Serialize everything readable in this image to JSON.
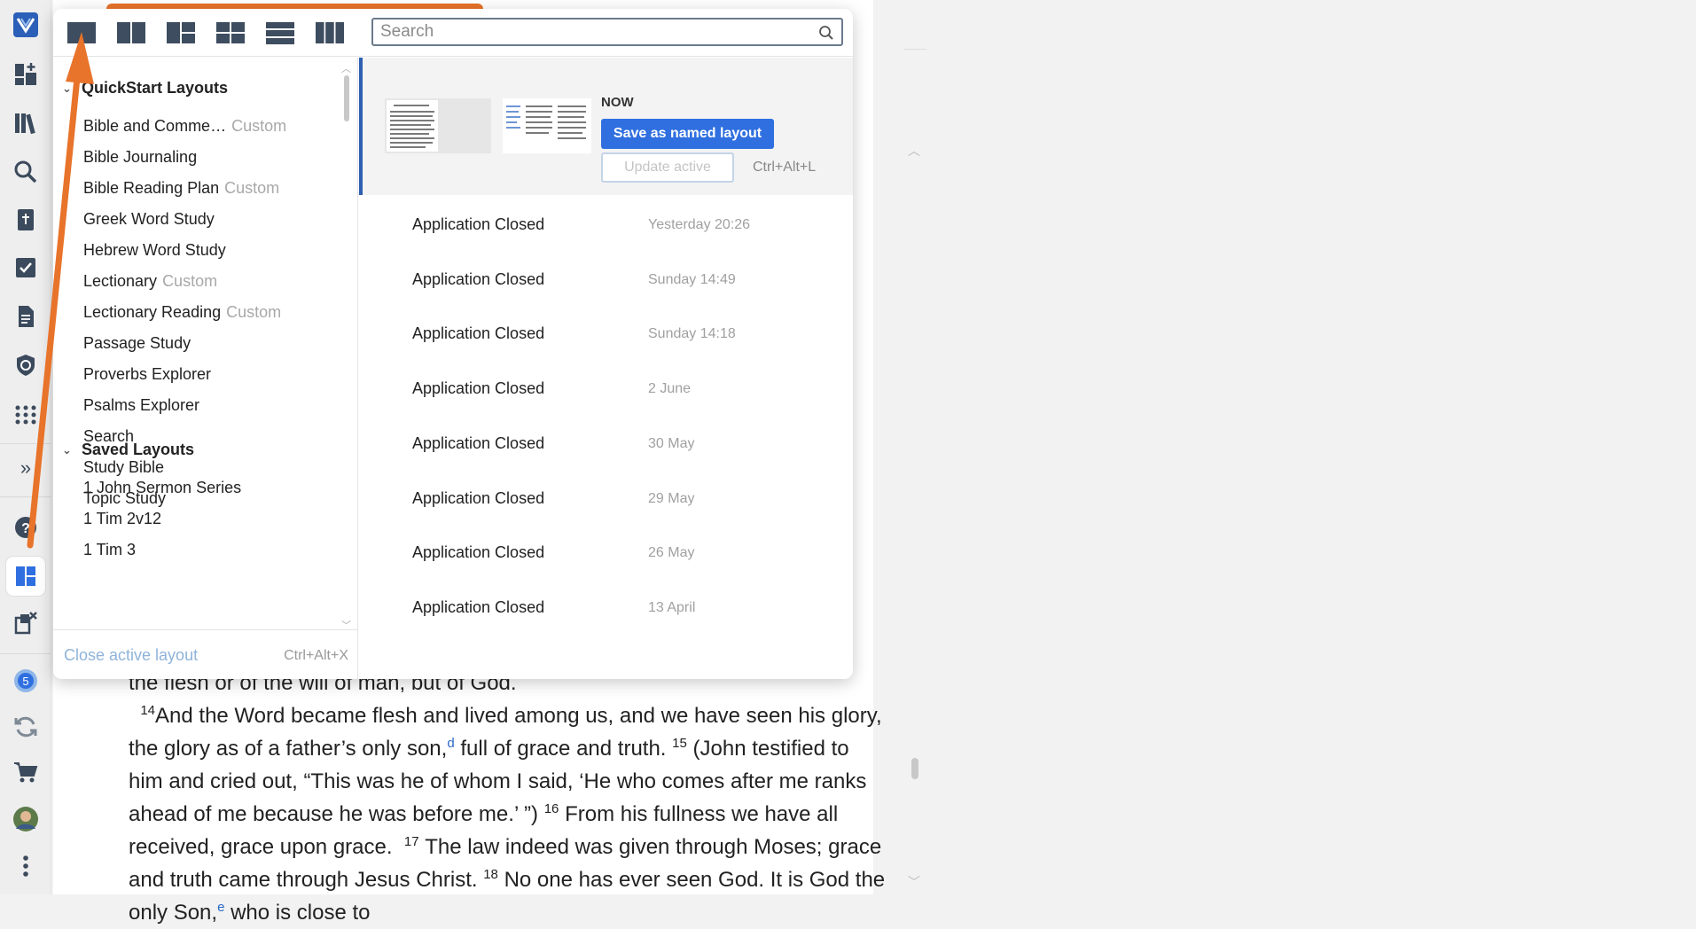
{
  "appbar": {
    "icons": [
      "logos-logo-icon",
      "dashboard-add-icon",
      "library-icon",
      "search-icon",
      "bible-icon",
      "checklist-icon",
      "document-icon",
      "shield-icon",
      "apps-grid-icon"
    ],
    "expand_label": "»",
    "bottom_icons": [
      "help-icon",
      "layouts-icon",
      "close-windows-icon",
      "badge-icon",
      "sync-icon",
      "cart-icon",
      "avatar",
      "more-icon"
    ],
    "badge_count": "5"
  },
  "toolbar": {
    "layout_buttons": [
      "single-panel-layout-icon",
      "two-column-layout-icon",
      "three-panel-layout-icon",
      "four-panel-layout-icon",
      "rows-layout-icon",
      "three-column-layout-icon"
    ],
    "search_placeholder": "Search"
  },
  "quickstart": {
    "title": "QuickStart Layouts",
    "items": [
      {
        "label": "Bible and Comme…",
        "tag": "Custom"
      },
      {
        "label": "Bible Journaling",
        "tag": ""
      },
      {
        "label": "Bible Reading Plan",
        "tag": "Custom"
      },
      {
        "label": "Greek Word Study",
        "tag": ""
      },
      {
        "label": "Hebrew Word Study",
        "tag": ""
      },
      {
        "label": "Lectionary",
        "tag": "Custom"
      },
      {
        "label": "Lectionary Reading",
        "tag": "Custom"
      },
      {
        "label": "Passage Study",
        "tag": ""
      },
      {
        "label": "Proverbs Explorer",
        "tag": ""
      },
      {
        "label": "Psalms Explorer",
        "tag": ""
      },
      {
        "label": "Search",
        "tag": ""
      },
      {
        "label": "Study Bible",
        "tag": ""
      },
      {
        "label": "Topic Study",
        "tag": ""
      }
    ]
  },
  "saved": {
    "title": "Saved Layouts",
    "items": [
      "1 John Sermon Series",
      "1 Tim 2v12",
      "1 Tim 3"
    ]
  },
  "footer": {
    "close_label": "Close active layout",
    "close_shortcut": "Ctrl+Alt+X"
  },
  "now": {
    "label": "NOW",
    "save_label": "Save as named layout",
    "update_label": "Update active",
    "update_shortcut": "Ctrl+Alt+L"
  },
  "history": [
    {
      "name": "Application Closed",
      "time": "Yesterday 20:26"
    },
    {
      "name": "Application Closed",
      "time": "Sunday 14:49"
    },
    {
      "name": "Application Closed",
      "time": "Sunday 14:18"
    },
    {
      "name": "Application Closed",
      "time": "2 June"
    },
    {
      "name": "Application Closed",
      "time": "30 May"
    },
    {
      "name": "Application Closed",
      "time": "29 May"
    },
    {
      "name": "Application Closed",
      "time": "26 May"
    },
    {
      "name": "Application Closed",
      "time": "13 April"
    }
  ],
  "document": {
    "line0": "the flesh or of the will of man, but of God.",
    "v14_num": "14",
    "v14_a": "And the Word became flesh and lived among us, and we have seen his glory, the glory as of a father’s only son,",
    "fn_d": "d",
    "v14_b": " full of grace and truth. ",
    "v15_num": "15",
    "v15": "(John testified to him and cried out, “This was he of whom I said, ‘He who comes after me ranks ahead of me because he was before me.’ ”) ",
    "v16_num": "16",
    "v16": "From his fullness we have all received, grace upon grace. ",
    "v17_num": "17",
    "v17": "The law indeed was given through Moses; grace and truth came through Jesus Christ. ",
    "v18_num": "18",
    "v18": "No one has ever seen God. It is God the only Son,",
    "fn_e": "e",
    "v18_b": " who is close to"
  },
  "colors": {
    "accent": "#2f6fe0",
    "annotation": "#e8732a",
    "active_bar": "#2f5fb0"
  }
}
